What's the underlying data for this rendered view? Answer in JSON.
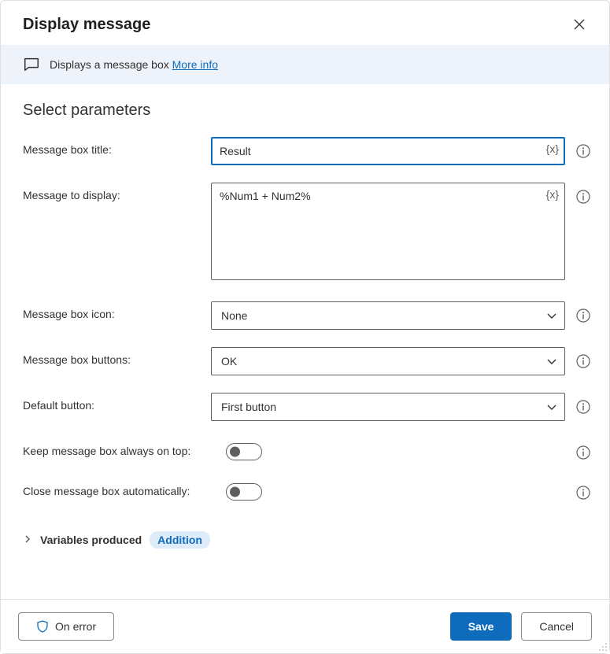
{
  "header": {
    "title": "Display message"
  },
  "description": {
    "text": "Displays a message box ",
    "more_info": "More info"
  },
  "section": {
    "title": "Select parameters"
  },
  "fields": {
    "title": {
      "label": "Message box title:",
      "value": "Result",
      "var_btn": "{x}"
    },
    "message": {
      "label": "Message to display:",
      "value": "%Num1 + Num2%",
      "var_btn": "{x}"
    },
    "icon": {
      "label": "Message box icon:",
      "value": "None"
    },
    "buttons": {
      "label": "Message box buttons:",
      "value": "OK"
    },
    "default": {
      "label": "Default button:",
      "value": "First button"
    },
    "ontop": {
      "label": "Keep message box always on top:",
      "value": false
    },
    "autoclose": {
      "label": "Close message box automatically:",
      "value": false
    }
  },
  "vars_produced": {
    "label": "Variables produced",
    "badge": "Addition"
  },
  "footer": {
    "on_error": "On error",
    "save": "Save",
    "cancel": "Cancel"
  }
}
